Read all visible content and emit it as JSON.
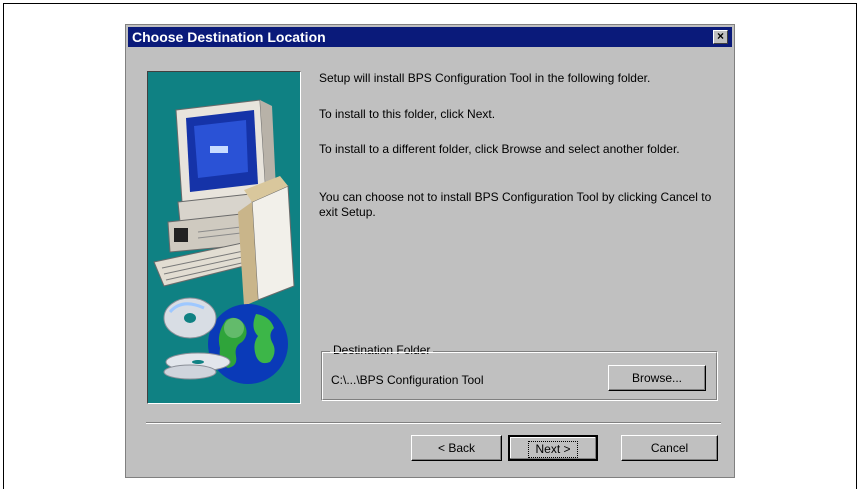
{
  "dialog": {
    "title": "Choose Destination Location",
    "close_label": "×"
  },
  "body": {
    "line1": "Setup will install BPS Configuration Tool in the following folder.",
    "line2": "To install to this folder, click Next.",
    "line3": "To install to a different folder, click Browse and select another folder.",
    "line4": "You can choose not to install BPS Configuration Tool by clicking Cancel to exit Setup."
  },
  "destination": {
    "group_label": "Destination Folder",
    "path": "C:\\...\\BPS Configuration Tool",
    "browse_label": "Browse..."
  },
  "buttons": {
    "back_label": "< Back",
    "next_label": "Next >",
    "cancel_label": "Cancel"
  },
  "colors": {
    "titlebar": "#0a1a7a",
    "face": "#c0c0c0",
    "illustration_bg": "#0f8183"
  },
  "icons": {
    "illustration": "computer-with-globe-and-cds"
  }
}
